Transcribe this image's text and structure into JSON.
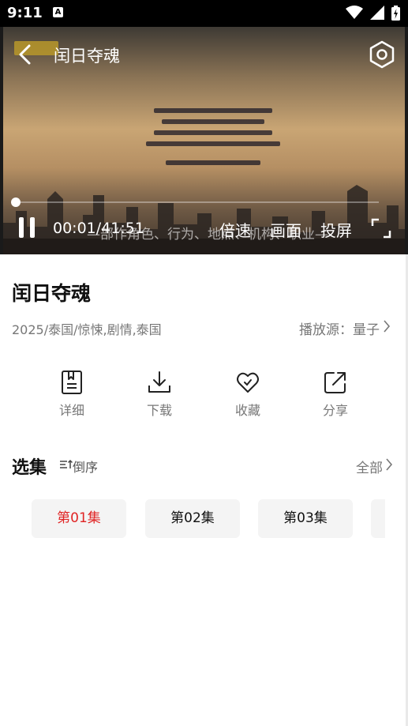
{
  "status_bar": {
    "time": "9:11",
    "notification_icon": "A"
  },
  "player": {
    "title": "闰日夺魂",
    "current_time": "00:01",
    "separator": "/",
    "total_time": "41:51",
    "subtitle": "—部作角色、行为、地点、机构、职业—",
    "controls": {
      "speed": "倍速",
      "picture": "画面",
      "cast": "投屏"
    },
    "progress": 0.01
  },
  "info": {
    "title": "闰日夺魂",
    "meta": "2025/泰国/惊悚,剧情,泰国",
    "source_label": "播放源：",
    "source_value": "量子"
  },
  "actions": [
    {
      "label": "详细",
      "icon": "details-icon"
    },
    {
      "label": "下载",
      "icon": "download-icon"
    },
    {
      "label": "收藏",
      "icon": "favorite-heart-icon"
    },
    {
      "label": "分享",
      "icon": "share-icon"
    }
  ],
  "episodes": {
    "title": "选集",
    "sort_label": "倒序",
    "all_label": "全部",
    "items": [
      {
        "label": "第01集",
        "active": true
      },
      {
        "label": "第02集",
        "active": false
      },
      {
        "label": "第03集",
        "active": false
      },
      {
        "label": "",
        "active": false
      }
    ]
  },
  "colors": {
    "accent_red": "#e02424",
    "muted_text": "#777777",
    "episode_bg": "#f4f4f4"
  }
}
